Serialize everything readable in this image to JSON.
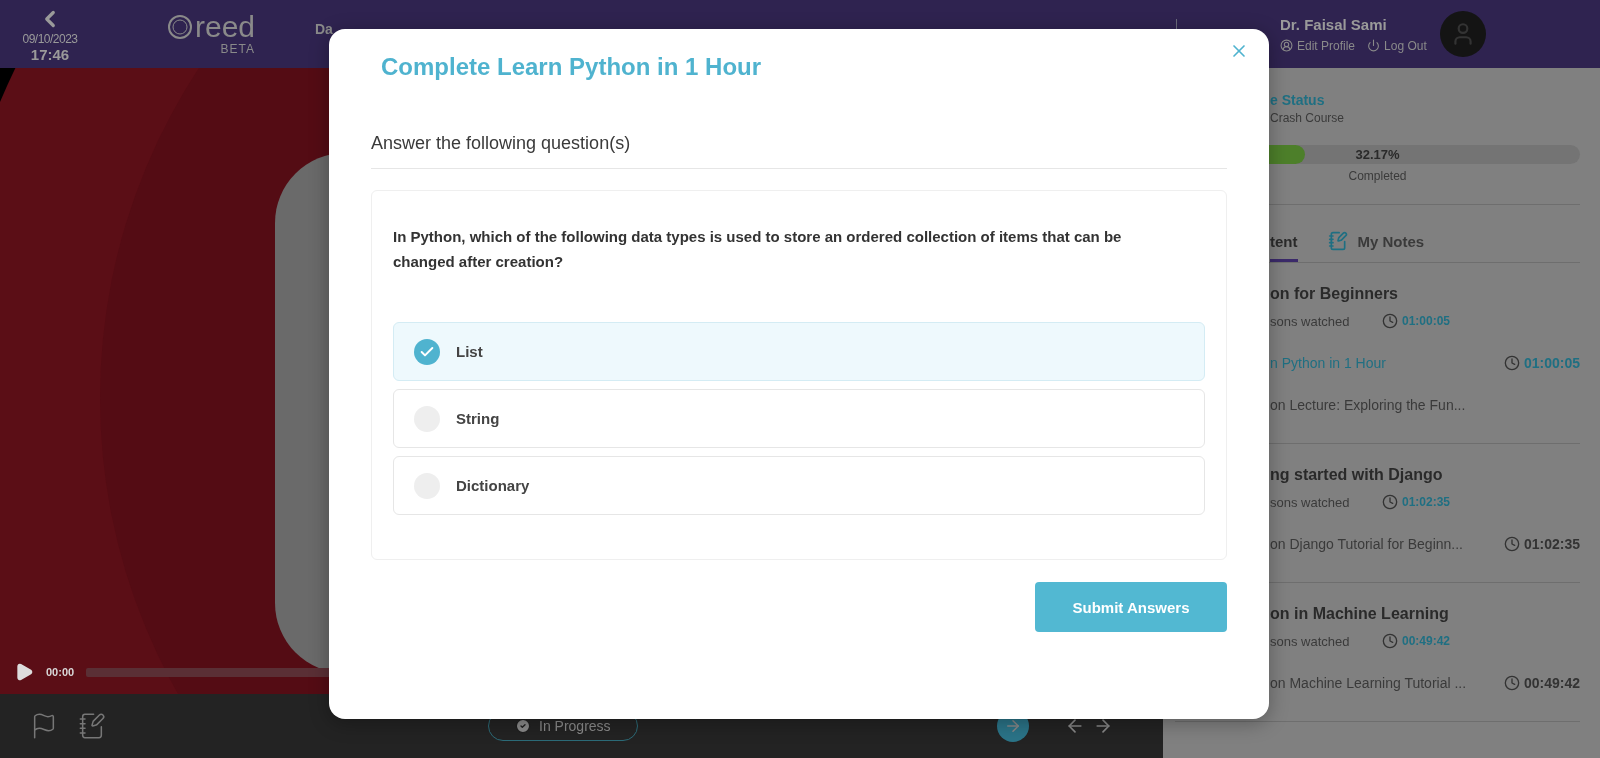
{
  "header": {
    "date": "09/10/2023",
    "time": "17:46",
    "logo": "reed",
    "logo_badge": "BETA",
    "course_title": "Da",
    "user_name": "Dr. Faisal Sami",
    "edit_profile": "Edit Profile",
    "log_out": "Log Out"
  },
  "player": {
    "elapsed": "00:00"
  },
  "bottom_bar": {
    "status": "In Progress"
  },
  "sidebar": {
    "status_title": "e Status",
    "course_name": "Crash Course",
    "progress": {
      "level": 0.3217,
      "percent": "32.17%",
      "caption": "Completed"
    },
    "tabs": [
      {
        "label": "tent",
        "selected": true
      },
      {
        "label": "My Notes",
        "selected": false
      }
    ],
    "sections": [
      {
        "title": "on for Beginners",
        "watched": "sons watched",
        "duration": "01:00:05",
        "lessons": [
          {
            "title": "n Python in 1 Hour",
            "duration": "01:00:05",
            "selected": true
          },
          {
            "title": "on Lecture: Exploring the Fun...",
            "selected": false
          }
        ]
      },
      {
        "title": "ng started with Django",
        "watched": "sons watched",
        "duration": "01:02:35",
        "lessons": [
          {
            "title": "on Django Tutorial for Beginn...",
            "duration": "01:02:35",
            "selected": false
          }
        ]
      },
      {
        "title": "on in Machine Learning",
        "watched": "sons watched",
        "duration": "00:49:42",
        "lessons": [
          {
            "title": "on Machine Learning Tutorial ...",
            "duration": "00:49:42",
            "selected": false
          }
        ]
      }
    ]
  },
  "modal": {
    "title": "Complete Learn Python in 1 Hour",
    "subtitle": "Answer the following question(s)",
    "question": "In Python, which of the following data types is used to store an ordered collection of items that can be changed after creation?",
    "options": [
      {
        "label": "List",
        "selected": true
      },
      {
        "label": "String",
        "selected": false
      },
      {
        "label": "Dictionary",
        "selected": false
      }
    ],
    "submit": "Submit Answers"
  }
}
